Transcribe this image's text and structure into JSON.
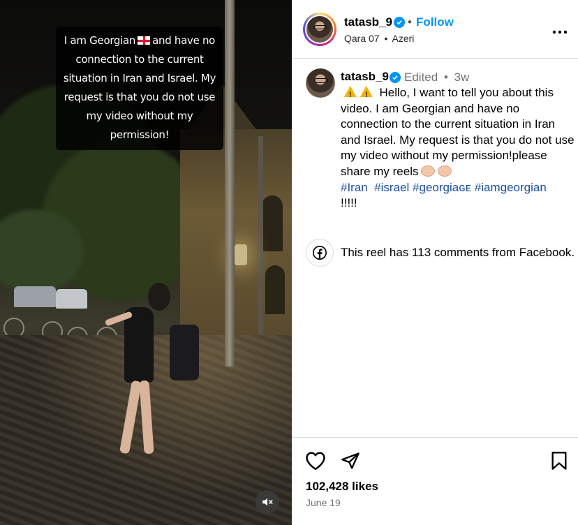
{
  "video": {
    "caption_part1": "I am Georgian",
    "caption_part2": "and have no connection to the current situation in Iran and Israel. My request is that you do not use my video without my permission!",
    "flag_icon": "georgia-flag-icon",
    "mute_icon": "muted-speaker-icon"
  },
  "header": {
    "username": "tatasb_9",
    "verified_icon": "verified-badge-icon",
    "separator": "•",
    "follow_label": "Follow",
    "audio": "Qara 07",
    "audio_separator": "•",
    "audio_artist": "Azeri",
    "more_label": "•••"
  },
  "post": {
    "username": "tatasb_9",
    "edited": "Edited",
    "separator": "•",
    "time_ago": "3w",
    "warning_icon": "warning-icon",
    "text": "Hello, I want to tell you about this video. I am Georgian and have no connection to the current situation in Iran and Israel. My request is that you do not use my video without my permission!please share my reels",
    "clap_icon": "clapping-hands-icon",
    "hashtags": [
      "#Iran",
      "#israel",
      "#georgiaɢᴇ",
      "#iamgeorgian"
    ],
    "trailing": "!!!!!"
  },
  "facebook_notice": {
    "icon": "facebook-icon",
    "text": "This reel has 113 comments from Facebook."
  },
  "actions": {
    "like_icon": "heart-icon",
    "share_icon": "send-icon",
    "save_icon": "bookmark-icon",
    "likes": "102,428 likes",
    "date": "June 19"
  },
  "colors": {
    "follow": "#0095f6",
    "verified": "#0095f6",
    "hashtag": "#1a4fa0",
    "muted_text": "#737373"
  }
}
